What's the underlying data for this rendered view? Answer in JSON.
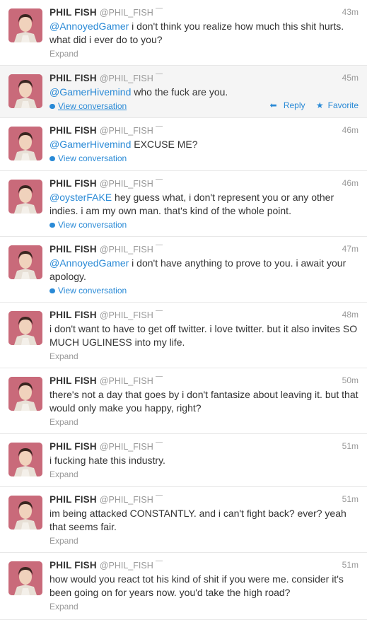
{
  "author": {
    "name": "PHIL FISH",
    "handle": "@PHIL_FISH"
  },
  "labels": {
    "expand": "Expand",
    "view_conversation": "View conversation",
    "reply": "Reply",
    "favorite": "Favorite"
  },
  "colors": {
    "link": "#2a8ad6",
    "muted": "#999999",
    "text": "#333333",
    "hover_bg": "#f5f5f5"
  },
  "tweets": [
    {
      "time": "43m",
      "mention": "@AnnoyedGamer",
      "text": " i don't think you realize how much this shit hurts. what did i ever do to you?",
      "action": "Expand"
    },
    {
      "time": "45m",
      "mention": "@GamerHivemind",
      "text": " who the fuck are you.",
      "action": "View conversation"
    },
    {
      "time": "46m",
      "mention": "@GamerHivemind",
      "text": " EXCUSE ME?",
      "action": "View conversation"
    },
    {
      "time": "46m",
      "mention": "@oysterFAKE",
      "text": " hey guess what, i don't represent you or any other indies. i am my own man. that's kind of the whole point.",
      "action": "View conversation"
    },
    {
      "time": "47m",
      "mention": "@AnnoyedGamer",
      "text": " i don't have anything to prove to you. i await your apology.",
      "action": "View conversation"
    },
    {
      "time": "48m",
      "mention": "",
      "text": "i don't want to have to get off twitter. i love twitter. but it also invites SO MUCH UGLINESS into my life.",
      "action": "Expand"
    },
    {
      "time": "50m",
      "mention": "",
      "text": "there's not a day that goes by i don't fantasize about leaving it. but that would only make you happy, right?",
      "action": "Expand"
    },
    {
      "time": "51m",
      "mention": "",
      "text": "i fucking hate this industry.",
      "action": "Expand"
    },
    {
      "time": "51m",
      "mention": "",
      "text": "im being attacked CONSTANTLY. and i can't fight back? ever? yeah that seems fair.",
      "action": "Expand"
    },
    {
      "time": "51m",
      "mention": "",
      "text": "how would you react tot his kind of shit if you were me. consider it's been going on for years now. you'd take the high road?",
      "action": "Expand"
    }
  ]
}
